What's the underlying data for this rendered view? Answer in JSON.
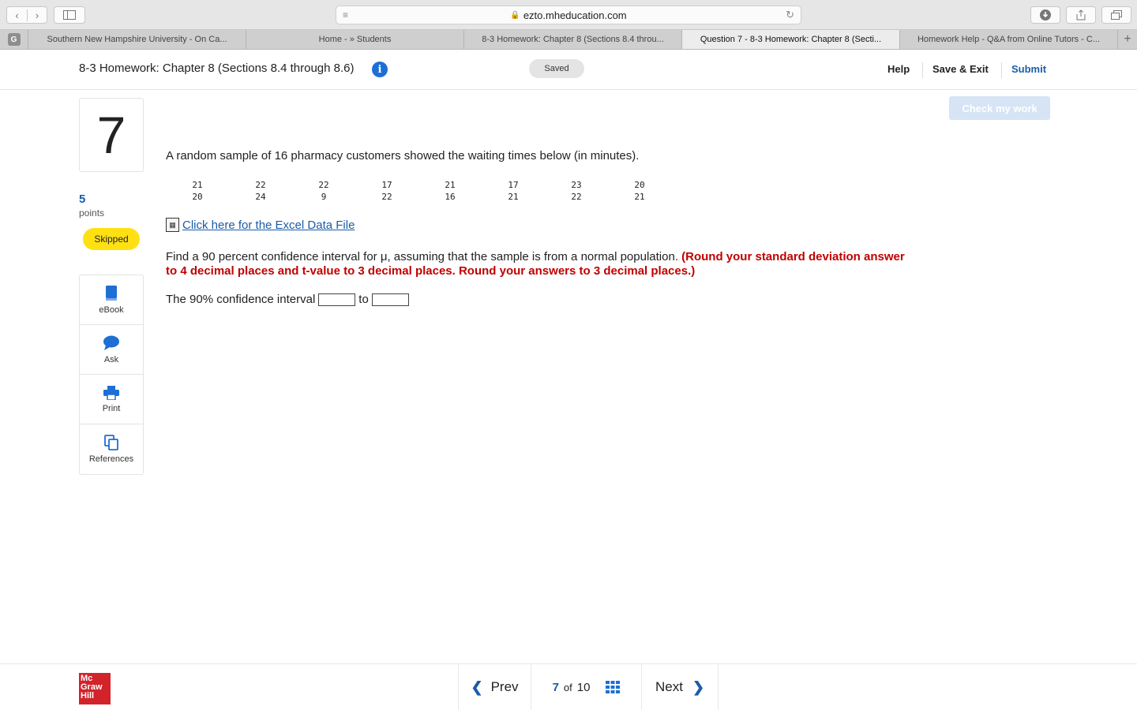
{
  "browser": {
    "url": "ezto.mheducation.com",
    "tabs": [
      {
        "label": "Southern New Hampshire University - On Ca..."
      },
      {
        "label": "Home - » Students"
      },
      {
        "label": "8-3 Homework: Chapter 8 (Sections 8.4 throu..."
      },
      {
        "label": "Question 7 - 8-3 Homework: Chapter 8 (Secti..."
      },
      {
        "label": "Homework Help - Q&A from Online Tutors - C..."
      }
    ],
    "favicon_letter": "G"
  },
  "header": {
    "assignment_title": "8-3 Homework: Chapter 8 (Sections 8.4 through 8.6)",
    "saved_label": "Saved",
    "help_label": "Help",
    "save_exit_label": "Save & Exit",
    "submit_label": "Submit"
  },
  "rail": {
    "question_number": "7",
    "points_value": "5",
    "points_label": "points",
    "status_badge": "Skipped",
    "tools": [
      {
        "label": "eBook",
        "icon": "book-icon"
      },
      {
        "label": "Ask",
        "icon": "chat-bubble-icon"
      },
      {
        "label": "Print",
        "icon": "printer-icon"
      },
      {
        "label": "References",
        "icon": "copy-icon"
      }
    ]
  },
  "main": {
    "check_label": "Check my work",
    "intro": "A random sample of 16 pharmacy customers showed the waiting times below (in minutes).",
    "data_rows": [
      [
        "21",
        "22",
        "22",
        "17",
        "21",
        "17",
        "23",
        "20"
      ],
      [
        "20",
        "24",
        "9",
        "22",
        "16",
        "21",
        "22",
        "21"
      ]
    ],
    "excel_link": " Click here for the Excel Data File",
    "question_text": "Find a 90 percent confidence interval for μ, assuming that the sample is from a normal population. ",
    "instruction": "(Round your standard deviation answer to 4 decimal places and t-value to 3 decimal places. Round your answers to 3 decimal places.)",
    "answer_prefix": "The 90% confidence interval",
    "answer_mid": "to",
    "answer_low": "",
    "answer_high": ""
  },
  "footer": {
    "logo_text": [
      "Mc",
      "Graw",
      "Hill"
    ],
    "prev_label": "Prev",
    "current_page": "7",
    "of_label": "of",
    "total_pages": "10",
    "next_label": "Next"
  },
  "colors": {
    "accent_blue": "#1a5ca8",
    "instruction_red": "#c00000",
    "skipped_yellow": "#ffe012",
    "logo_red": "#d2232a"
  }
}
